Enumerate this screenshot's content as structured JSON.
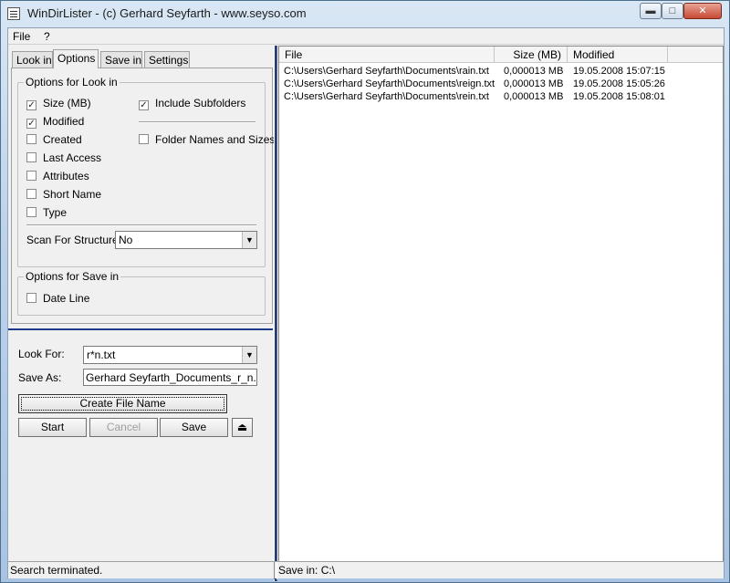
{
  "window": {
    "title": "WinDirLister - (c) Gerhard Seyfarth - www.seyso.com",
    "minimize_glyph": "▬",
    "maximize_glyph": "□",
    "close_glyph": "✕"
  },
  "menu": [
    "File",
    "?"
  ],
  "tabs": [
    "Look in",
    "Options",
    "Save in",
    "Settings"
  ],
  "options": {
    "group_title": "Options for Look in",
    "left_checks": [
      {
        "label": "Size (MB)",
        "checked": true
      },
      {
        "label": "Modified",
        "checked": true
      },
      {
        "label": "Created",
        "checked": false
      },
      {
        "label": "Last Access",
        "checked": false
      },
      {
        "label": "Attributes",
        "checked": false
      },
      {
        "label": "Short Name",
        "checked": false
      },
      {
        "label": "Type",
        "checked": false
      }
    ],
    "right_checks": [
      {
        "label": "Include Subfolders",
        "checked": true
      },
      {
        "label": "Folder Names and Sizes",
        "checked": false
      }
    ],
    "scan_label": "Scan For Structure:",
    "scan_value": "No",
    "save_group_title": "Options for Save in",
    "save_checks": [
      {
        "label": "Date Line",
        "checked": false
      }
    ]
  },
  "search": {
    "look_for_label": "Look For:",
    "look_for_value": "r*n.txt",
    "save_as_label": "Save As:",
    "save_as_value": "Gerhard Seyfarth_Documents_r_n.txt.txt",
    "create_button": "Create File Name",
    "start_button": "Start",
    "cancel_button": "Cancel",
    "save_button": "Save",
    "eject_glyph": "⏏"
  },
  "list": {
    "columns": [
      "File",
      "Size (MB)",
      "Modified"
    ],
    "rows": [
      {
        "file": "C:\\Users\\Gerhard Seyfarth\\Documents\\rain.txt",
        "size": "0,000013 MB",
        "modified": "19.05.2008 15:07:15"
      },
      {
        "file": "C:\\Users\\Gerhard Seyfarth\\Documents\\reign.txt",
        "size": "0,000013 MB",
        "modified": "19.05.2008 15:05:26"
      },
      {
        "file": "C:\\Users\\Gerhard Seyfarth\\Documents\\rein.txt",
        "size": "0,000013 MB",
        "modified": "19.05.2008 15:08:01"
      }
    ]
  },
  "status": {
    "left": "Search terminated.",
    "right": "Save in: C:\\"
  }
}
